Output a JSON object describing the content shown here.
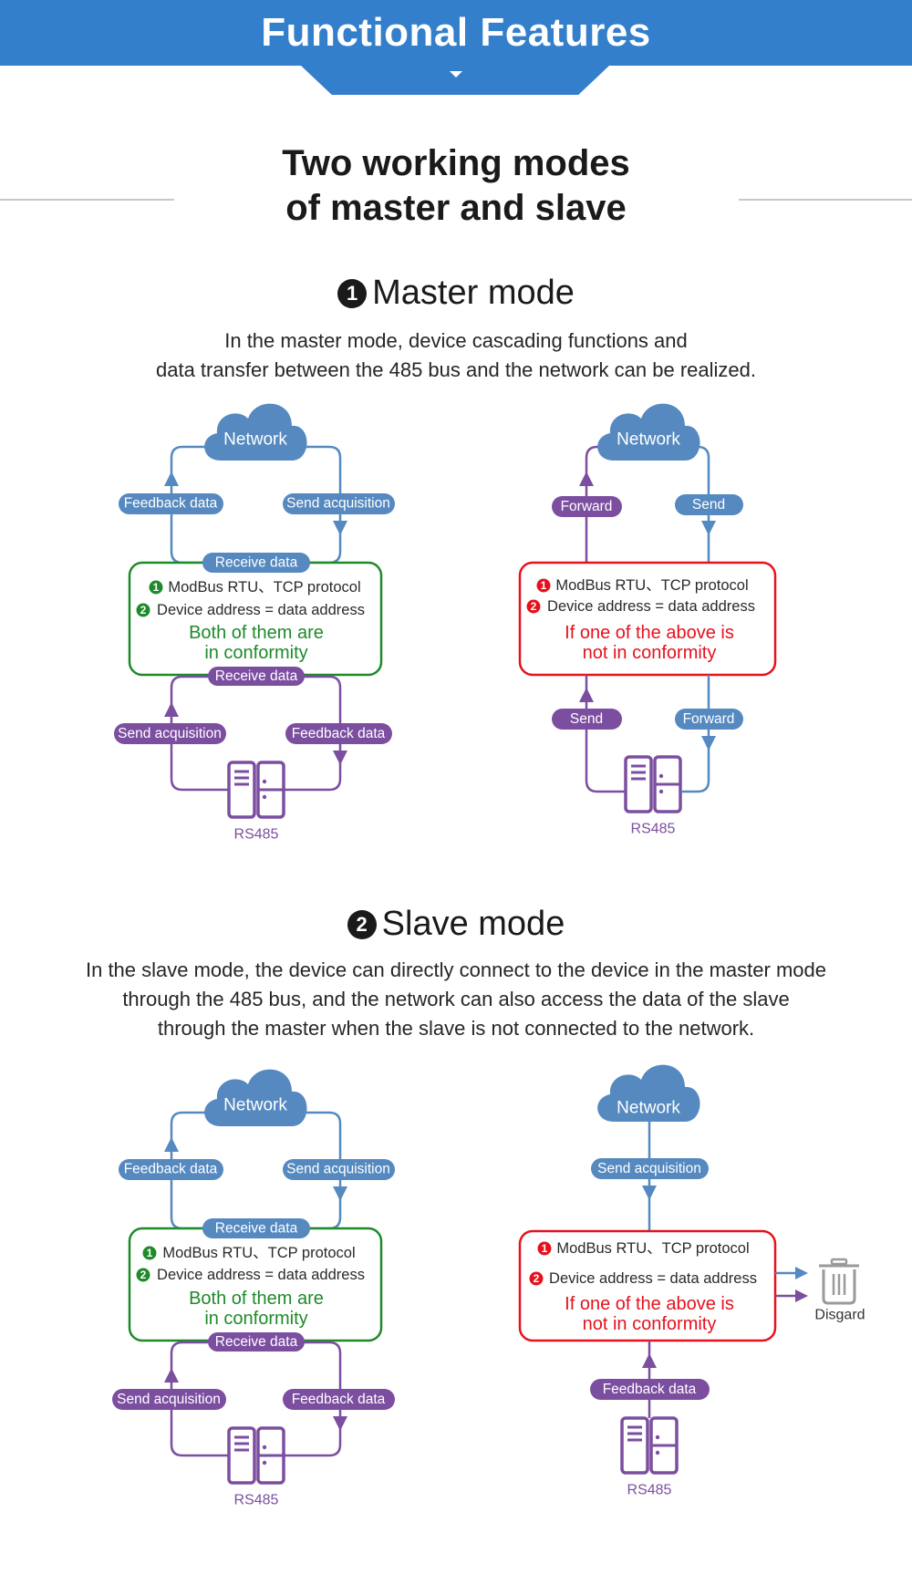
{
  "header": {
    "title": "Functional Features"
  },
  "main_title": {
    "line1": "Two working modes",
    "line2": "of master and slave"
  },
  "colors": {
    "header_blue": "#337fcb",
    "network_blue": "#5589c0",
    "bus_purple": "#7b4ea0",
    "ok_green": "#1e8a2a",
    "fail_red": "#e5121e",
    "discard_gray": "#9a9a9a",
    "divider_gray": "#c8c8c8"
  },
  "master": {
    "number": "1",
    "title": "Master mode",
    "desc": [
      "In the master mode, device cascading functions and",
      "data transfer between the 485 bus and the network can be realized."
    ],
    "ok_diagram": {
      "network": "Network",
      "feedback_up": "Feedback data",
      "send_down": "Send acquisition",
      "receive_top": "Receive data",
      "condition1": "ModBus RTU、TCP protocol",
      "condition2": "Device address = data address",
      "result_line1": "Both of them are",
      "result_line2": "in conformity",
      "receive_bottom": "Receive data",
      "send_up": "Send acquisition",
      "feedback_down": "Feedback data",
      "device": "RS485"
    },
    "fail_diagram": {
      "network": "Network",
      "forward_up": "Forward",
      "send_down": "Send",
      "condition1": "ModBus RTU、TCP protocol",
      "condition2": "Device address = data address",
      "result_line1": "If one of the above is",
      "result_line2": "not in conformity",
      "send_up": "Send",
      "forward_down": "Forward",
      "device": "RS485"
    }
  },
  "slave": {
    "number": "2",
    "title": "Slave mode",
    "desc": [
      "In the slave mode, the device can directly connect to the device in the master mode",
      "through the 485 bus, and the network can also access the data of the slave",
      "through the master when the slave is not connected to the network."
    ],
    "ok_diagram": {
      "network": "Network",
      "feedback_up": "Feedback data",
      "send_down": "Send acquisition",
      "receive_top": "Receive data",
      "condition1": "ModBus RTU、TCP protocol",
      "condition2": "Device address = data address",
      "result_line1": "Both of them are",
      "result_line2": "in conformity",
      "receive_bottom": "Receive data",
      "send_up": "Send acquisition",
      "feedback_down": "Feedback data",
      "device": "RS485"
    },
    "fail_diagram": {
      "network": "Network",
      "send_down": "Send acquisition",
      "condition1": "ModBus RTU、TCP protocol",
      "condition2": "Device address = data address",
      "result_line1": "If one of the above is",
      "result_line2": "not in conformity",
      "feedback_up": "Feedback data",
      "device": "RS485",
      "discard": "Disgard"
    }
  },
  "bullets": {
    "one": "1",
    "two": "2"
  }
}
